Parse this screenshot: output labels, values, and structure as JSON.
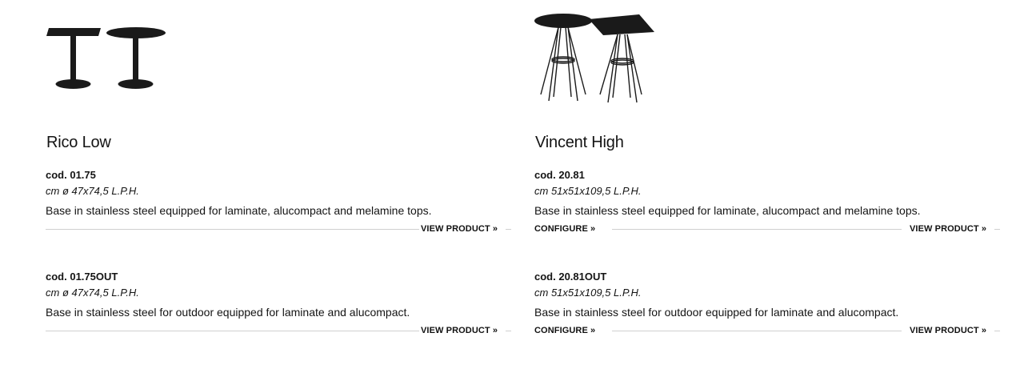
{
  "products": [
    {
      "name": "Rico Low",
      "image_icon": "table-pair-icon",
      "variants": [
        {
          "code": "cod. 01.75",
          "dimensions": "cm ø 47x74,5 L.P.H.",
          "description": "Base in stainless steel equipped for laminate, alucompact and melamine tops.",
          "view_label": "VIEW PRODUCT »"
        },
        {
          "code": "cod. 01.75OUT",
          "dimensions": "cm ø 47x74,5 L.P.H.",
          "description": "Base in stainless steel for outdoor equipped for laminate and alucompact.",
          "view_label": "VIEW PRODUCT »"
        }
      ]
    },
    {
      "name": "Vincent High",
      "image_icon": "high-table-pair-icon",
      "variants": [
        {
          "code": "cod. 20.81",
          "dimensions": "cm 51x51x109,5 L.P.H.",
          "description": "Base in stainless steel equipped for laminate, alucompact and melamine tops.",
          "configure_label": "CONFIGURE »",
          "view_label": "VIEW PRODUCT »"
        },
        {
          "code": "cod. 20.81OUT",
          "dimensions": "cm 51x51x109,5 L.P.H.",
          "description": "Base in stainless steel for outdoor equipped for laminate and alucompact.",
          "configure_label": "CONFIGURE »",
          "view_label": "VIEW PRODUCT »"
        }
      ]
    }
  ],
  "colors": {
    "text": "#141414",
    "rule": "#cfcfcf",
    "product_fill": "#1a1a1a"
  }
}
